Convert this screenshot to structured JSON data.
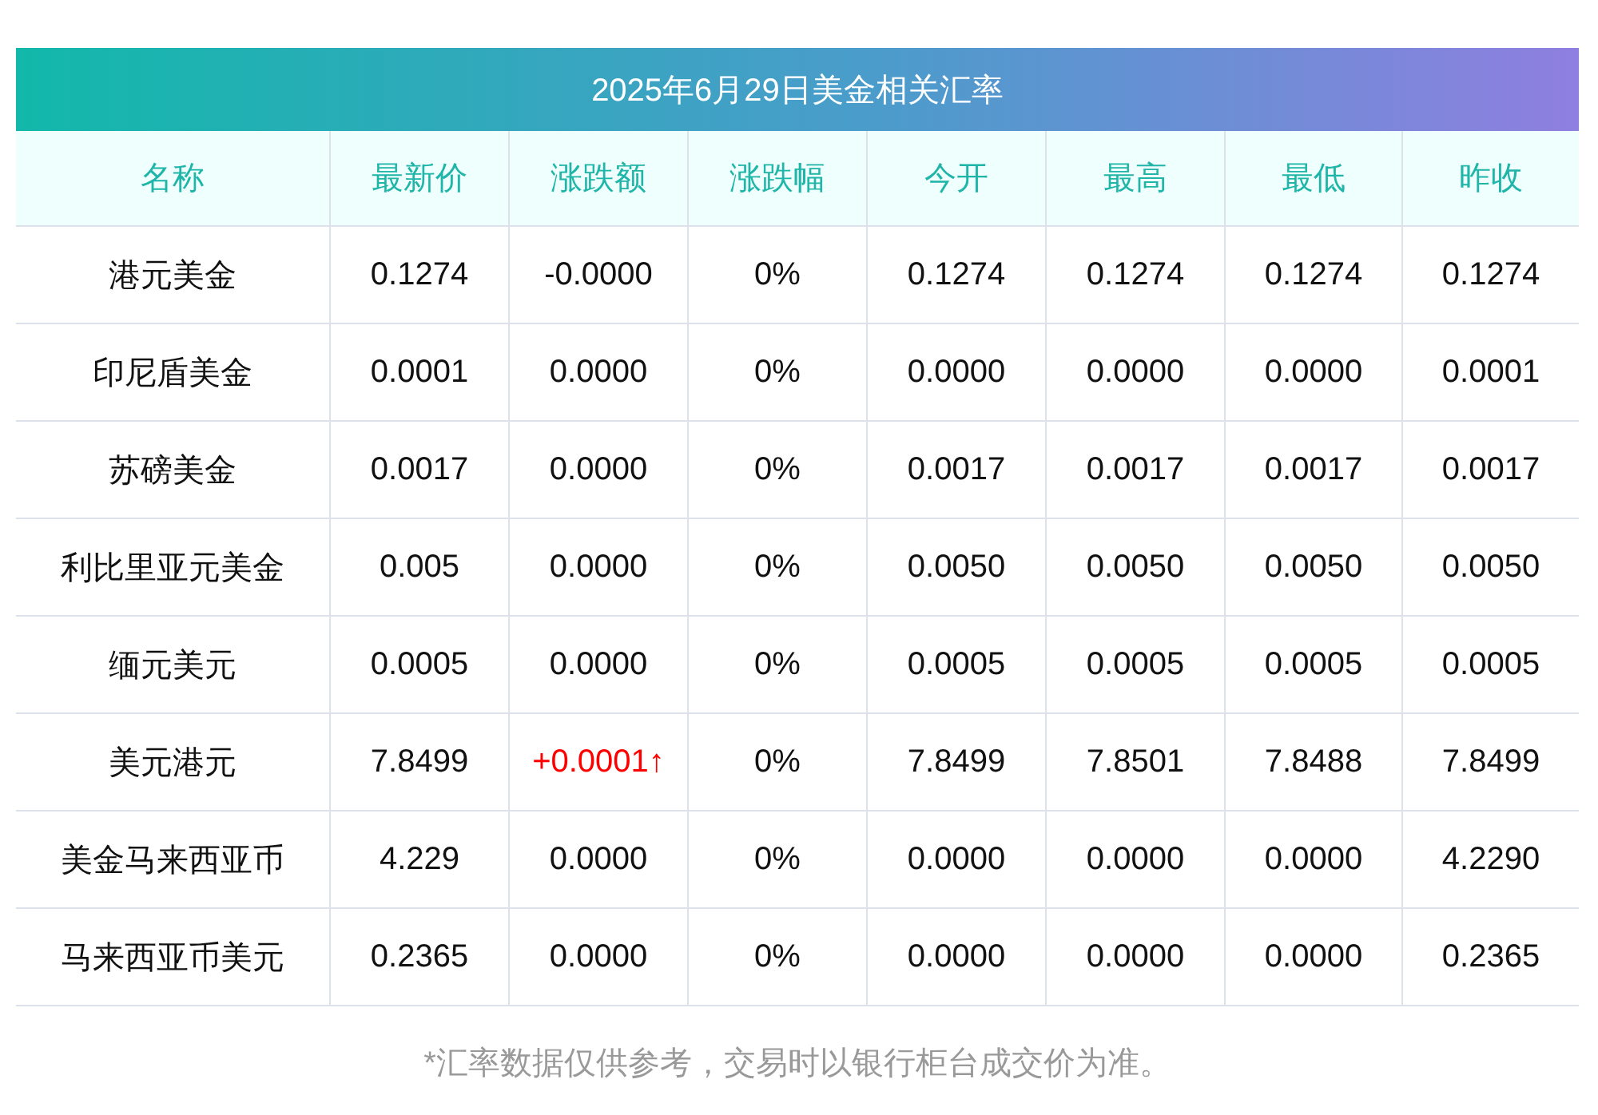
{
  "table": {
    "title": "2025年6月29日美金相关汇率",
    "columns": [
      "名称",
      "最新价",
      "涨跌额",
      "涨跌幅",
      "今开",
      "最高",
      "最低",
      "昨收"
    ],
    "rows": [
      {
        "cells": [
          "港元美金",
          "0.1274",
          "-0.0000",
          "0%",
          "0.1274",
          "0.1274",
          "0.1274",
          "0.1274"
        ],
        "rising": false
      },
      {
        "cells": [
          "印尼盾美金",
          "0.0001",
          "0.0000",
          "0%",
          "0.0000",
          "0.0000",
          "0.0000",
          "0.0001"
        ],
        "rising": false
      },
      {
        "cells": [
          "苏磅美金",
          "0.0017",
          "0.0000",
          "0%",
          "0.0017",
          "0.0017",
          "0.0017",
          "0.0017"
        ],
        "rising": false
      },
      {
        "cells": [
          "利比里亚元美金",
          "0.005",
          "0.0000",
          "0%",
          "0.0050",
          "0.0050",
          "0.0050",
          "0.0050"
        ],
        "rising": false
      },
      {
        "cells": [
          "缅元美元",
          "0.0005",
          "0.0000",
          "0%",
          "0.0005",
          "0.0005",
          "0.0005",
          "0.0005"
        ],
        "rising": false
      },
      {
        "cells": [
          "美元港元",
          "7.8499",
          "+0.0001↑",
          "0%",
          "7.8499",
          "7.8501",
          "7.8488",
          "7.8499"
        ],
        "rising": true
      },
      {
        "cells": [
          "美金马来西亚币",
          "4.229",
          "0.0000",
          "0%",
          "0.0000",
          "0.0000",
          "0.0000",
          "4.2290"
        ],
        "rising": false
      },
      {
        "cells": [
          "马来西亚币美元",
          "0.2365",
          "0.0000",
          "0%",
          "0.0000",
          "0.0000",
          "0.0000",
          "0.2365"
        ],
        "rising": false
      }
    ]
  },
  "footnote": "*汇率数据仅供参考，交易时以银行柜台成交价为准。"
}
